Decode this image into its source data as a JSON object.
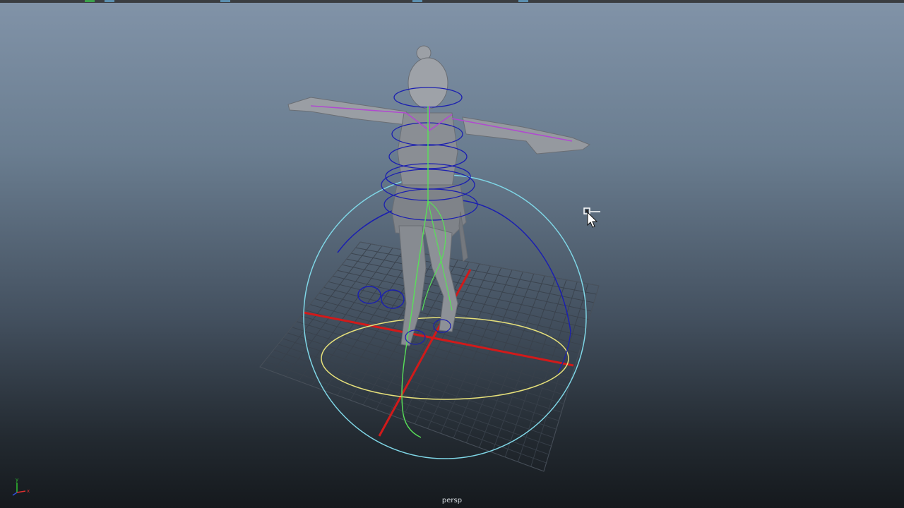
{
  "viewport": {
    "camera_label": "persp"
  },
  "axis_gizmo": {
    "y_label": "y",
    "x_label": "x",
    "colors": {
      "x": "#e03030",
      "y": "#30c030",
      "z": "#3050e0"
    }
  },
  "scene": {
    "grid_color": "#39414b",
    "x_axis_color": "#d11a1a",
    "z_axis_color": "#d11a1a",
    "spine_color": "#58e058",
    "outer_sphere_color": "#7fd6e6",
    "yellow_ring_color": "#e6e07a",
    "blue_control_color": "#1b1fb0",
    "joint_color": "#b04ad0",
    "mesh_color": "#8f9399"
  }
}
